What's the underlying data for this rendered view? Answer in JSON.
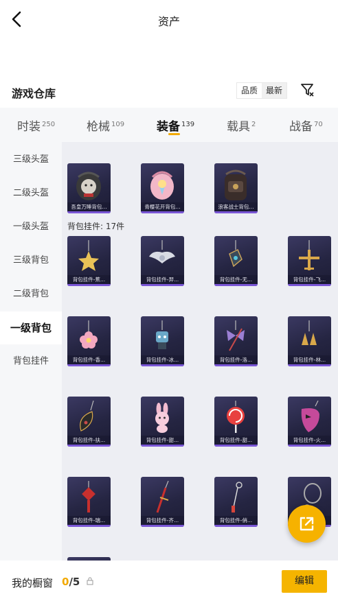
{
  "header": {
    "title": "资产"
  },
  "warehouse": {
    "title": "游戏仓库",
    "sort": {
      "quality": "品质",
      "newest": "最新"
    }
  },
  "tabs": [
    {
      "label": "时装",
      "count": "250"
    },
    {
      "label": "枪械",
      "count": "109"
    },
    {
      "label": "装备",
      "count": "139"
    },
    {
      "label": "载具",
      "count": "2"
    },
    {
      "label": "战备",
      "count": "70"
    }
  ],
  "active_tab": "装备",
  "sidebar": {
    "items": [
      {
        "label": "三级头盔"
      },
      {
        "label": "二级头盔"
      },
      {
        "label": "一级头盔"
      },
      {
        "label": "三级背包"
      },
      {
        "label": "二级背包"
      },
      {
        "label": "一级背包"
      },
      {
        "label": "背包挂件"
      }
    ],
    "active": "一级背包"
  },
  "backpacks": [
    {
      "label": "吾皇万睡背包...",
      "icon": "cat-backpack-icon"
    },
    {
      "label": "青樱花开背包...",
      "icon": "sakura-backpack-icon"
    },
    {
      "label": "浪客战士背包...",
      "icon": "ronin-backpack-icon"
    }
  ],
  "pendants_title": "背包挂件: 17件",
  "pendants": [
    {
      "label": "背包挂件-蕉...",
      "icon": "star-pendant-icon"
    },
    {
      "label": "背包挂件-羿...",
      "icon": "wing-pendant-icon"
    },
    {
      "label": "背包挂件-无...",
      "icon": "lantern-pendant-icon"
    },
    {
      "label": "背包挂件-飞...",
      "icon": "plane-pendant-icon"
    },
    {
      "label": "背包挂件-香...",
      "icon": "flower-pendant-icon"
    },
    {
      "label": "背包挂件-冰...",
      "icon": "robot-pendant-icon"
    },
    {
      "label": "背包挂件-洛...",
      "icon": "bow-pendant-icon"
    },
    {
      "label": "背包挂件-林...",
      "icon": "bell-pendant-icon"
    },
    {
      "label": "背包挂件-扶...",
      "icon": "leaf-pendant-icon"
    },
    {
      "label": "背包挂件-甜...",
      "icon": "bunny-pendant-icon"
    },
    {
      "label": "背包挂件-甜...",
      "icon": "lollipop-pendant-icon"
    },
    {
      "label": "背包挂件-火...",
      "icon": "mask-pendant-icon"
    },
    {
      "label": "背包挂件-瑞...",
      "icon": "knot-pendant-icon"
    },
    {
      "label": "背包挂件-齐...",
      "icon": "sword-pendant-icon"
    },
    {
      "label": "背包挂件-俏...",
      "icon": "tassel-pendant-icon"
    },
    {
      "label": "背包挂件-...",
      "icon": "chain-pendant-icon"
    }
  ],
  "showcase": {
    "label": "我的橱窗",
    "current": "0",
    "total": "/5"
  },
  "edit_label": "编辑"
}
